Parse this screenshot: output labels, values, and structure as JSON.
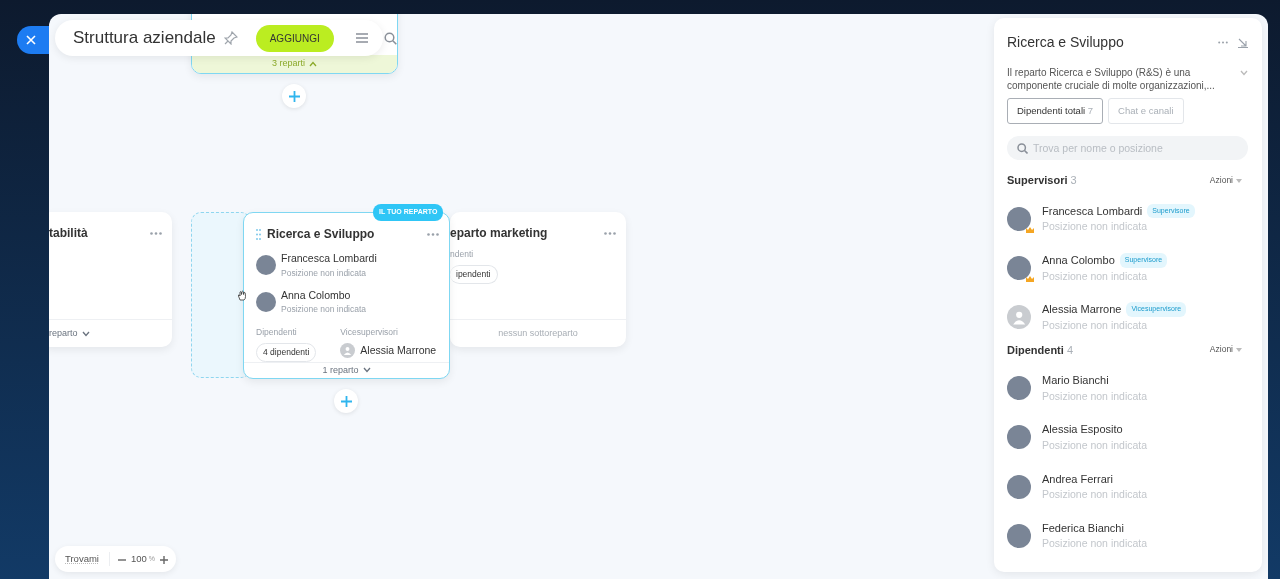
{
  "header": {
    "title": "Struttura aziendale",
    "pinned": false,
    "add_button": "AGGIUNGI"
  },
  "canvas": {
    "nodes": [
      {
        "kind": "collapsed",
        "footer": "3 reparti",
        "highlighted": true,
        "expanded": true
      },
      {
        "kind": "department",
        "title": "tabilità",
        "footer": "reparto",
        "expanded": false
      },
      {
        "kind": "department",
        "title": "Ricerca e Sviluppo",
        "badge": "IL TUO REPARTO",
        "highlighted": true,
        "people": [
          {
            "name": "Francesca Lombardi",
            "position": "Posizione non indicata",
            "photo": true
          },
          {
            "name": "Anna Colombo",
            "position": "Posizione non indicata",
            "photo": true
          }
        ],
        "employees_label": "Dipendenti",
        "employees": "4 dipendenti",
        "deputies_label": "Vicesupervisori",
        "deputy": {
          "name": "Alessia Marrone",
          "photo": false
        },
        "footer": "1 reparto",
        "expanded": false
      },
      {
        "kind": "department",
        "title": "eparto marketing",
        "employees_label": "ndenti",
        "employees": "ipendenti",
        "footer": "nessun sottoreparto"
      }
    ],
    "zoom": {
      "find_me": "Trovami",
      "value": "100",
      "unit": "%"
    }
  },
  "panel": {
    "title": "Ricerca e Sviluppo",
    "description": "Il reparto Ricerca e Sviluppo (R&S) è una componente cruciale di molte organizzazioni,...",
    "tabs": [
      {
        "label": "Dipendenti totali",
        "count": "7",
        "selected": true
      },
      {
        "label": "Chat e canali",
        "selected": false
      }
    ],
    "search": {
      "placeholder": "Trova per nome o posizione"
    },
    "sections": [
      {
        "title": "Supervisori",
        "count": "3",
        "action": "Azioni",
        "people": [
          {
            "name": "Francesca Lombardi",
            "role": "Supervisore",
            "position": "Posizione non indicata",
            "photo": true,
            "head": true
          },
          {
            "name": "Anna Colombo",
            "role": "Supervisore",
            "position": "Posizione non indicata",
            "photo": true,
            "head": true
          },
          {
            "name": "Alessia Marrone",
            "role": "Vicesupervisore",
            "position": "Posizione non indicata",
            "photo": false
          }
        ]
      },
      {
        "title": "Dipendenti",
        "count": "4",
        "action": "Azioni",
        "people": [
          {
            "name": "Mario Bianchi",
            "position": "Posizione non indicata",
            "photo": true
          },
          {
            "name": "Alessia Esposito",
            "position": "Posizione non indicata",
            "photo": true
          },
          {
            "name": "Andrea Ferrari",
            "position": "Posizione non indicata",
            "photo": true
          },
          {
            "name": "Federica Bianchi",
            "position": "Posizione non indicata",
            "photo": true
          }
        ]
      }
    ]
  }
}
